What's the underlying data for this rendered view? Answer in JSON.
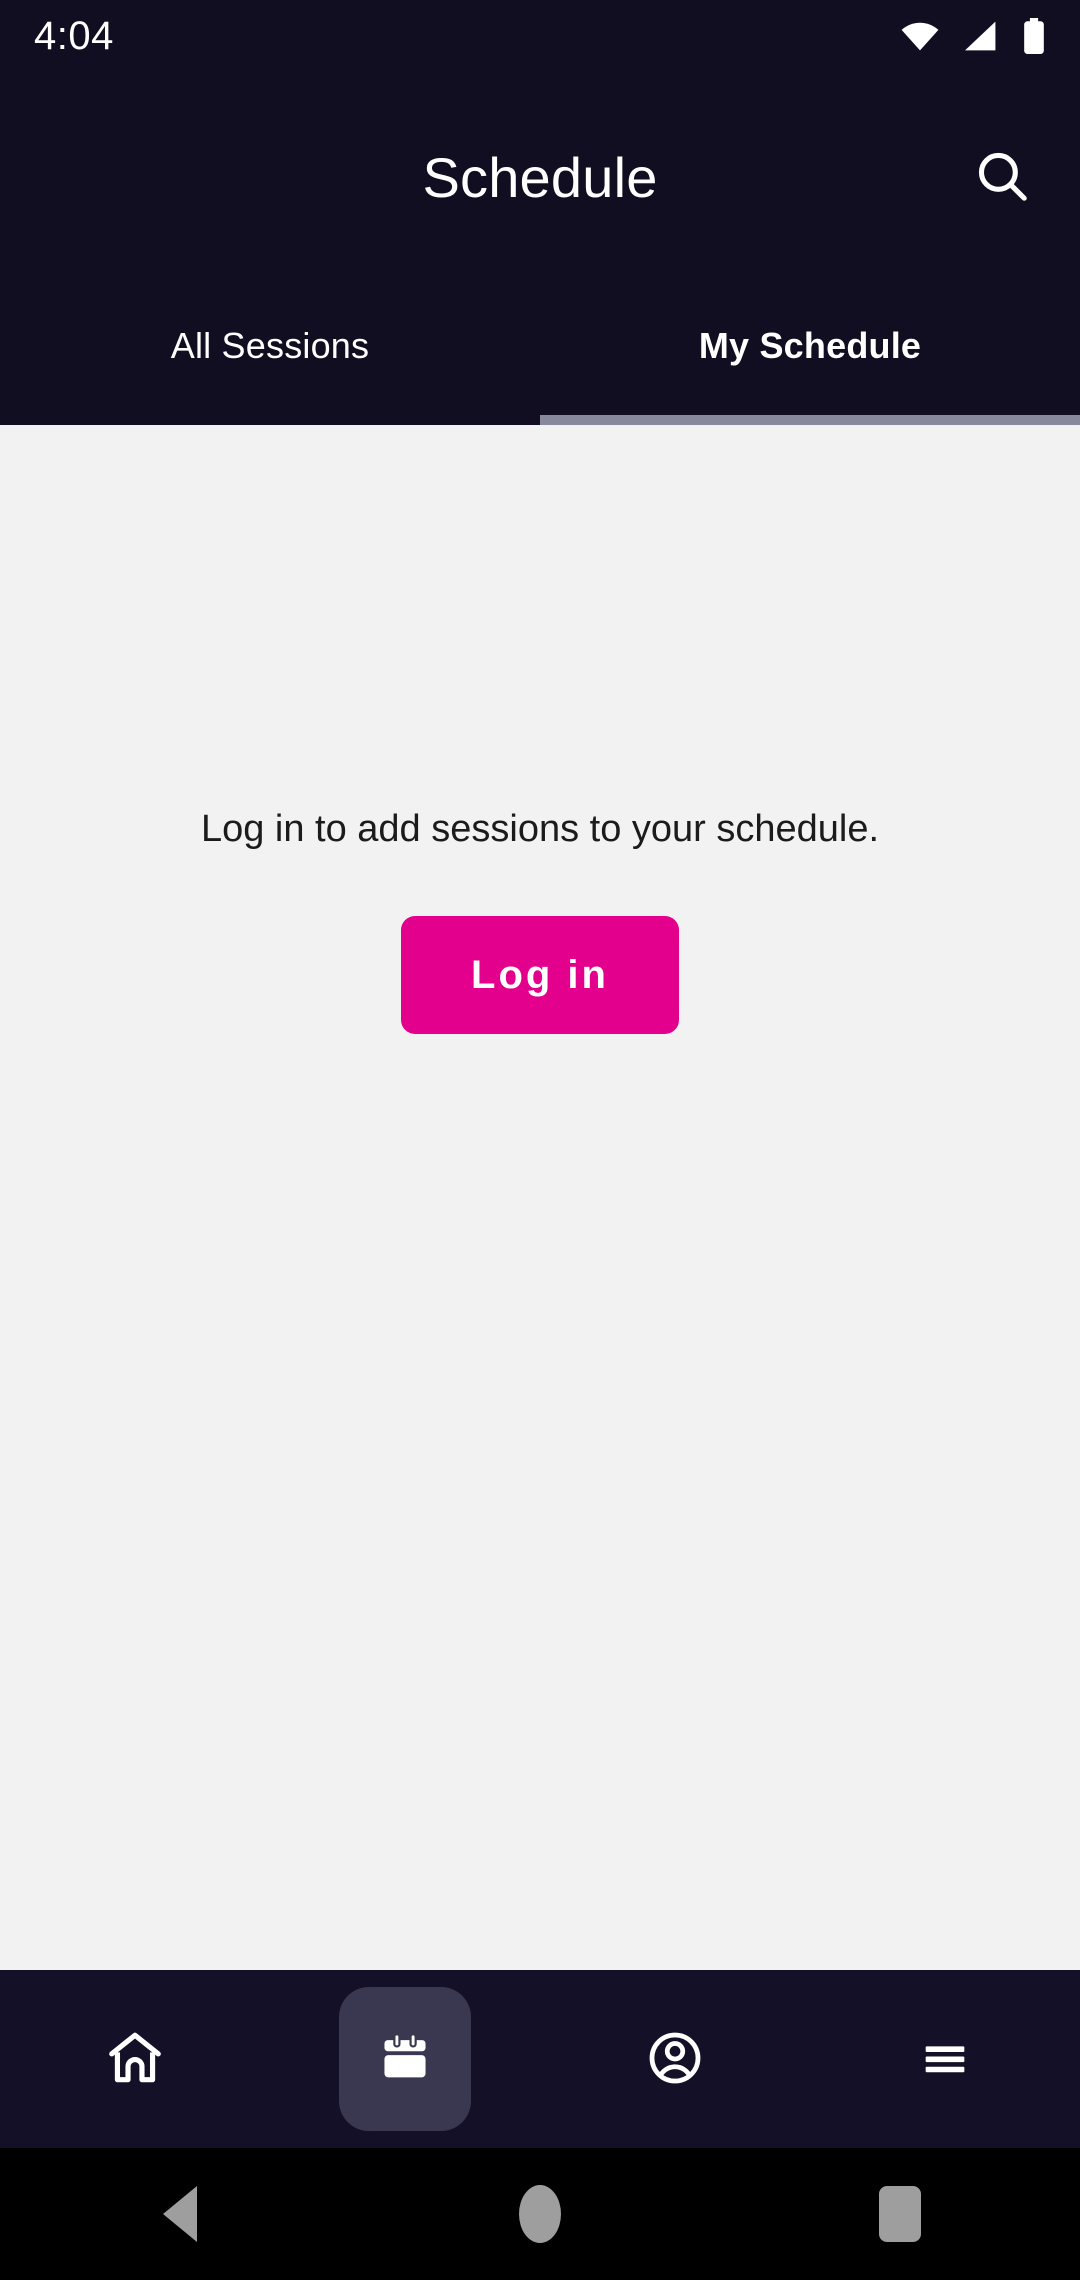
{
  "status_bar": {
    "clock": "4:04",
    "icons": [
      "wifi-icon",
      "cellular-signal-icon",
      "battery-full-icon"
    ]
  },
  "app_bar": {
    "title": "Schedule",
    "search_icon": "search-icon"
  },
  "tabs": [
    {
      "label": "All Sessions",
      "active": false
    },
    {
      "label": "My Schedule",
      "active": true
    }
  ],
  "content": {
    "empty_message": "Log in to add sessions to your schedule.",
    "login_button_label": "Log in"
  },
  "bottom_nav": [
    {
      "icon": "home-icon",
      "active": false
    },
    {
      "icon": "calendar-icon",
      "active": true
    },
    {
      "icon": "account-circle-icon",
      "active": false
    },
    {
      "icon": "menu-hamburger-icon",
      "active": false
    }
  ],
  "system_nav": [
    {
      "icon": "back-triangle-icon"
    },
    {
      "icon": "home-circle-icon"
    },
    {
      "icon": "recents-square-icon"
    }
  ],
  "colors": {
    "header_background": "#120e21",
    "content_background": "#f2f2f2",
    "accent_pink": "#e2008c",
    "tab_indicator": "#88889c",
    "nav_background": "#141027",
    "nav_active_pill": "#3a3850",
    "system_nav_background": "#000000",
    "system_nav_icon": "#9e9e9e"
  }
}
